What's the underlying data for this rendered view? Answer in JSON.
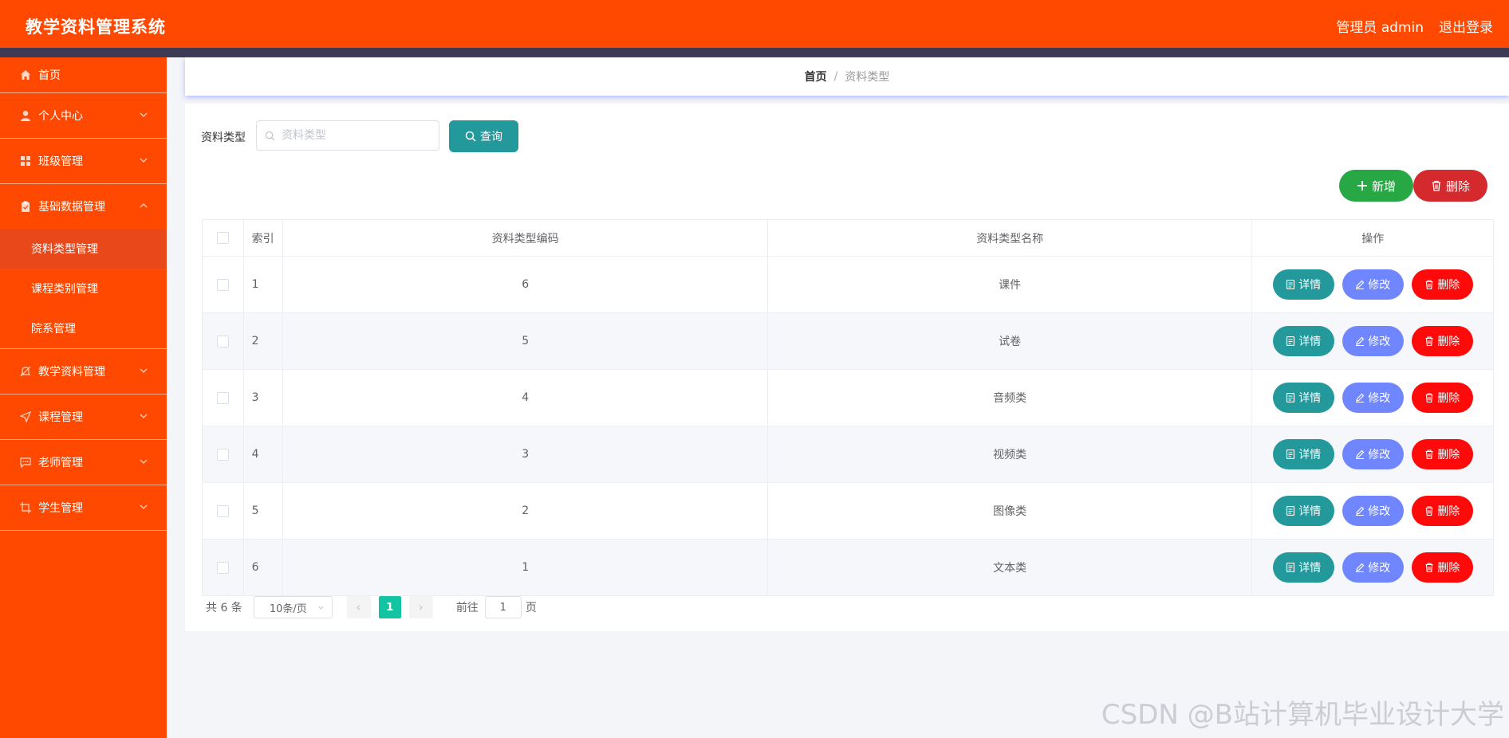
{
  "header": {
    "title": "教学资料管理系统",
    "user": "管理员 admin",
    "logout": "退出登录"
  },
  "sidebar": {
    "home": "首页",
    "personal": "个人中心",
    "class": "班级管理",
    "basic": "基础数据管理",
    "basic_sub": [
      "资料类型管理",
      "课程类别管理",
      "院系管理"
    ],
    "material": "教学资料管理",
    "course": "课程管理",
    "teacher": "老师管理",
    "student": "学生管理"
  },
  "breadcrumb": {
    "home": "首页",
    "sep": "/",
    "current": "资料类型"
  },
  "search": {
    "label": "资料类型",
    "placeholder": "资料类型",
    "value": "",
    "button": "查询"
  },
  "actions": {
    "add": "新增",
    "delete": "删除"
  },
  "table": {
    "headers": {
      "index": "索引",
      "code": "资料类型编码",
      "name": "资料类型名称",
      "ops": "操作"
    },
    "row_actions": {
      "detail": "详情",
      "edit": "修改",
      "delete": "删除"
    },
    "rows": [
      {
        "index": "1",
        "code": "6",
        "name": "课件"
      },
      {
        "index": "2",
        "code": "5",
        "name": "试卷"
      },
      {
        "index": "3",
        "code": "4",
        "name": "音频类"
      },
      {
        "index": "4",
        "code": "3",
        "name": "视频类"
      },
      {
        "index": "5",
        "code": "2",
        "name": "图像类"
      },
      {
        "index": "6",
        "code": "1",
        "name": "文本类"
      }
    ]
  },
  "pagination": {
    "total": "共 6 条",
    "page_size": "10条/页",
    "current": "1",
    "goto": "前往",
    "goto_value": "1",
    "page_unit": "页"
  },
  "watermark": "CSDN @B站计算机毕业设计大学",
  "colors": {
    "accent": "#ff4800",
    "teal": "#23999c",
    "edit": "#6f86ff",
    "danger": "#ff0a0a",
    "green": "#28a745"
  }
}
